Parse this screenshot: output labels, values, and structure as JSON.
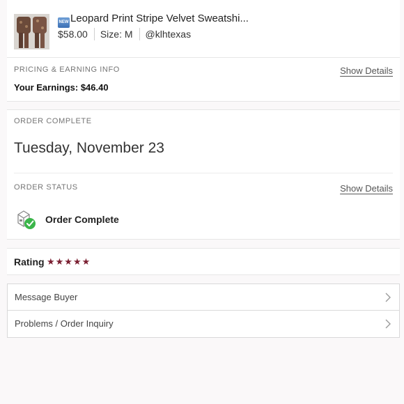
{
  "product": {
    "badge": "NEW",
    "title": "Leopard Print Stripe Velvet Sweatshi...",
    "price": "$58.00",
    "size": "Size: M",
    "seller": "@klhtexas"
  },
  "pricing": {
    "label": "PRICING & EARNING INFO",
    "show_details": "Show Details",
    "earnings": "Your Earnings: $46.40"
  },
  "order_complete": {
    "label": "ORDER COMPLETE",
    "date": "Tuesday, November 23",
    "status_label": "ORDER STATUS",
    "show_details": "Show Details",
    "status_text": "Order Complete",
    "status_icon": "package-check-icon"
  },
  "rating": {
    "label": "Rating",
    "stars": 5,
    "stars_display": "★★★★★",
    "star_color": "#7b2032"
  },
  "menu": {
    "items": [
      {
        "label": "Message Buyer",
        "icon": "chevron-right-icon"
      },
      {
        "label": "Problems / Order Inquiry",
        "icon": "chevron-right-icon"
      }
    ]
  },
  "colors": {
    "accent": "#7b2032",
    "success": "#3bb54a"
  }
}
